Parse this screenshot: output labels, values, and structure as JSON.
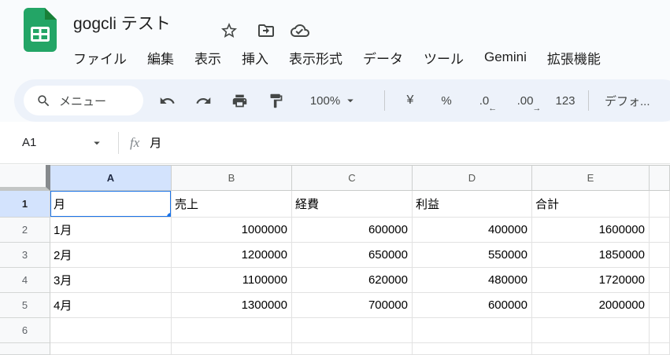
{
  "titlebar": {
    "title": "gogcli テスト",
    "icons": [
      "star",
      "move-to-folder",
      "cloud-saved"
    ]
  },
  "menubar": {
    "items": [
      "ファイル",
      "編集",
      "表示",
      "挿入",
      "表示形式",
      "データ",
      "ツール",
      "Gemini",
      "拡張機能"
    ]
  },
  "toolbar": {
    "search_label": "メニュー",
    "zoom_value": "100%",
    "currency_label": "¥",
    "percent_label": "%",
    "decrease_decimal_label": ".0",
    "decrease_decimal_arrow": "←",
    "increase_decimal_label": ".00",
    "increase_decimal_arrow": "→",
    "more_formats_label": "123",
    "font_label": "デフォ..."
  },
  "formula_bar": {
    "cell_reference": "A1",
    "fx_label": "fx",
    "value": "月"
  },
  "sheet": {
    "selected_cell": "A1",
    "column_headers": [
      "A",
      "B",
      "C",
      "D",
      "E",
      ""
    ],
    "row_headers": [
      "1",
      "2",
      "3",
      "4",
      "5",
      "6",
      ""
    ],
    "rows": [
      [
        "月",
        "売上",
        "経費",
        "利益",
        "合計",
        ""
      ],
      [
        "1月",
        "1000000",
        "600000",
        "400000",
        "1600000",
        ""
      ],
      [
        "2月",
        "1200000",
        "650000",
        "550000",
        "1850000",
        ""
      ],
      [
        "3月",
        "1100000",
        "620000",
        "480000",
        "1720000",
        ""
      ],
      [
        "4月",
        "1300000",
        "700000",
        "600000",
        "2000000",
        ""
      ],
      [
        "",
        "",
        "",
        "",
        "",
        ""
      ],
      [
        "",
        "",
        "",
        "",
        "",
        ""
      ]
    ]
  },
  "colors": {
    "selection_blue": "#1a73e8",
    "selected_header_bg": "#d3e3fd",
    "toolbar_bg": "#edf2fa",
    "chrome_bg": "#f9fbfd",
    "logo_green": "#23a566",
    "logo_fold_green": "#188038"
  }
}
